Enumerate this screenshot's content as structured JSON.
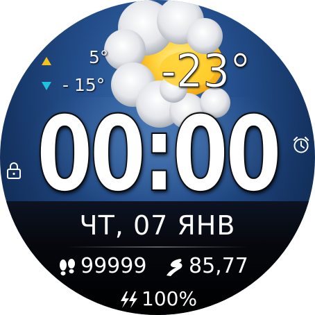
{
  "colors": {
    "hi_indicator": "#f4c21b",
    "lo_indicator": "#1ec3e0",
    "text": "#ffffff",
    "sky_top": "#3a6fb0",
    "sky_bottom": "#0b1f3f"
  },
  "weather": {
    "condition_icon": "sun-behind-cloud-icon",
    "high": "5°",
    "low": "- 15°",
    "current": "-23°"
  },
  "time": {
    "display": "00:00"
  },
  "date": {
    "display": "ЧТ, 07 ЯНВ"
  },
  "stats": {
    "steps": "99999",
    "steps_icon": "footprints-icon",
    "distance": "85,77",
    "distance_icon": "runner-icon",
    "battery": "100%",
    "battery_icon": "lightning-icon"
  },
  "shortcuts": {
    "left_icon": "lock-icon",
    "right_icon": "alarm-clock-icon"
  }
}
